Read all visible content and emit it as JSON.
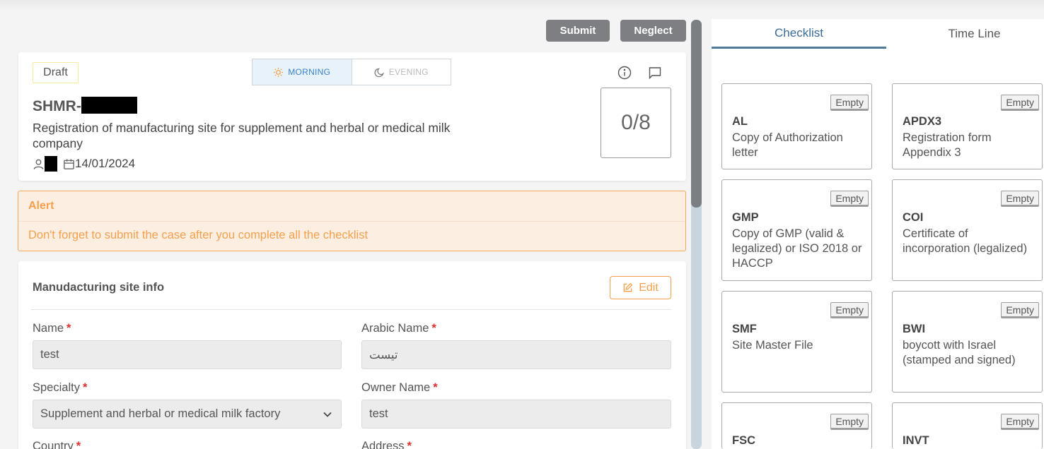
{
  "toolbar": {
    "submit_label": "Submit",
    "neglect_label": "Neglect"
  },
  "header": {
    "status": "Draft",
    "shifts": [
      {
        "label": "MORNING",
        "icon": "sun-icon",
        "active": true
      },
      {
        "label": "EVENING",
        "icon": "moon-icon",
        "active": false
      }
    ],
    "case_code_prefix": "SHMR-",
    "case_title": "Registration of manufacturing site for supplement and herbal or medical milk company",
    "date": "14/01/2024",
    "progress": "0/8"
  },
  "alert": {
    "title": "Alert",
    "message": "Don't forget to submit the case after you complete all the checklist"
  },
  "site_info": {
    "title": "Manudacturing site info",
    "edit_label": "Edit",
    "fields": {
      "name": {
        "label": "Name",
        "value": "test"
      },
      "arabic_name": {
        "label": "Arabic Name",
        "value": "تيست"
      },
      "specialty": {
        "label": "Specialty",
        "value": "Supplement and herbal or medical milk factory"
      },
      "owner_name": {
        "label": "Owner Name",
        "value": "test"
      },
      "country": {
        "label": "Country"
      },
      "address": {
        "label": "Address"
      }
    }
  },
  "tabs": {
    "checklist": "Checklist",
    "timeline": "Time Line"
  },
  "checklist": [
    {
      "code": "AL",
      "desc": "Copy of Authorization letter",
      "status": "Empty"
    },
    {
      "code": "APDX3",
      "desc": "Registration form Appendix 3",
      "status": "Empty"
    },
    {
      "code": "GMP",
      "desc": "Copy of GMP (valid & legalized) or ISO 2018 or HACCP",
      "status": "Empty"
    },
    {
      "code": "COI",
      "desc": "Certificate of incorporation (legalized)",
      "status": "Empty"
    },
    {
      "code": "SMF",
      "desc": "Site Master File",
      "status": "Empty"
    },
    {
      "code": "BWI",
      "desc": "boycott with Israel (stamped and signed)",
      "status": "Empty"
    },
    {
      "code": "FSC",
      "desc": "",
      "status": "Empty"
    },
    {
      "code": "INVT",
      "desc": "",
      "status": "Empty"
    }
  ],
  "colors": {
    "accent_orange": "#f5a04e",
    "alert_bg": "#fdeee2",
    "tab_active": "#3a6a96",
    "button_grey": "#7d7f82",
    "required_red": "#e03030"
  }
}
